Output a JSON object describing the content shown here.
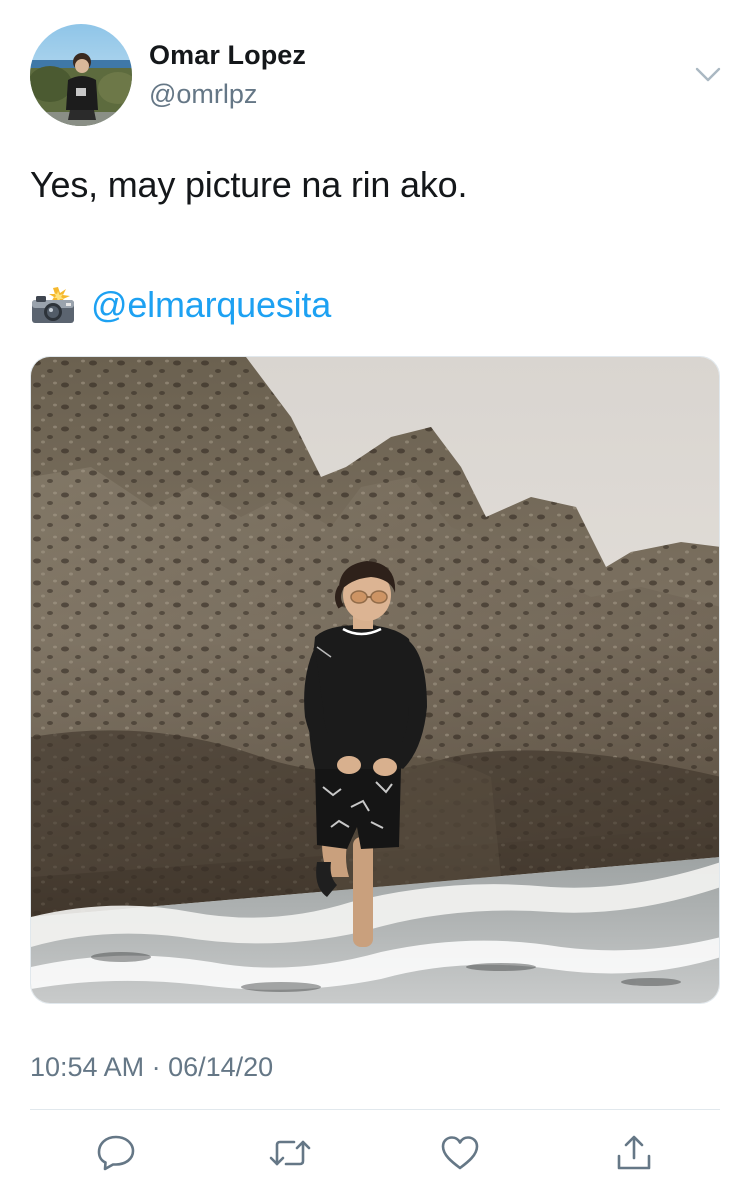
{
  "tweet": {
    "author": {
      "name": "Omar Lopez",
      "handle": "@omrlpz"
    },
    "text": "Yes, may picture na rin ako.",
    "credit_emoji": "camera-with-flash-icon",
    "credit_mention": "@elmarquesita",
    "timestamp": "10:54 AM · 06/14/20"
  },
  "actions": [
    "reply-icon",
    "retweet-icon",
    "like-icon",
    "share-icon"
  ],
  "colors": {
    "text_primary": "#14171a",
    "text_secondary": "#657786",
    "link": "#1da1f2",
    "divider": "#e1e8ed"
  }
}
